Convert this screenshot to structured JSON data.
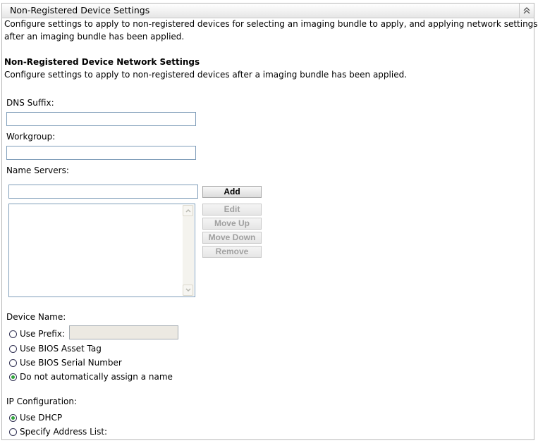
{
  "panel": {
    "title": "Non-Registered Device Settings",
    "collapse_icon": "double-chevron-up-icon",
    "description_line1": "Configure settings to apply to non-registered devices for selecting an imaging bundle to apply, and applying network settings",
    "description_line2": "after an imaging bundle has been applied."
  },
  "network": {
    "heading": "Non-Registered Device Network Settings",
    "description": "Configure settings to apply to non-registered devices after a imaging bundle has been applied.",
    "dns_suffix_label": "DNS Suffix:",
    "dns_suffix_value": "",
    "workgroup_label": "Workgroup:",
    "workgroup_value": "",
    "name_servers_label": "Name Servers:",
    "name_server_input_value": "",
    "name_servers_list": [],
    "buttons": {
      "add": "Add",
      "edit": "Edit",
      "move_up": "Move Up",
      "move_down": "Move Down",
      "remove": "Remove"
    }
  },
  "device_name": {
    "label": "Device Name:",
    "options": [
      {
        "label": "Use Prefix:",
        "checked": false
      },
      {
        "label": "Use BIOS Asset Tag",
        "checked": false
      },
      {
        "label": "Use BIOS Serial Number",
        "checked": false
      },
      {
        "label": "Do not automatically assign a name",
        "checked": true
      }
    ],
    "prefix_value": ""
  },
  "ip_configuration": {
    "label": "IP Configuration:",
    "options": [
      {
        "label": "Use DHCP",
        "checked": true
      },
      {
        "label": "Specify Address List:",
        "checked": false
      }
    ]
  }
}
